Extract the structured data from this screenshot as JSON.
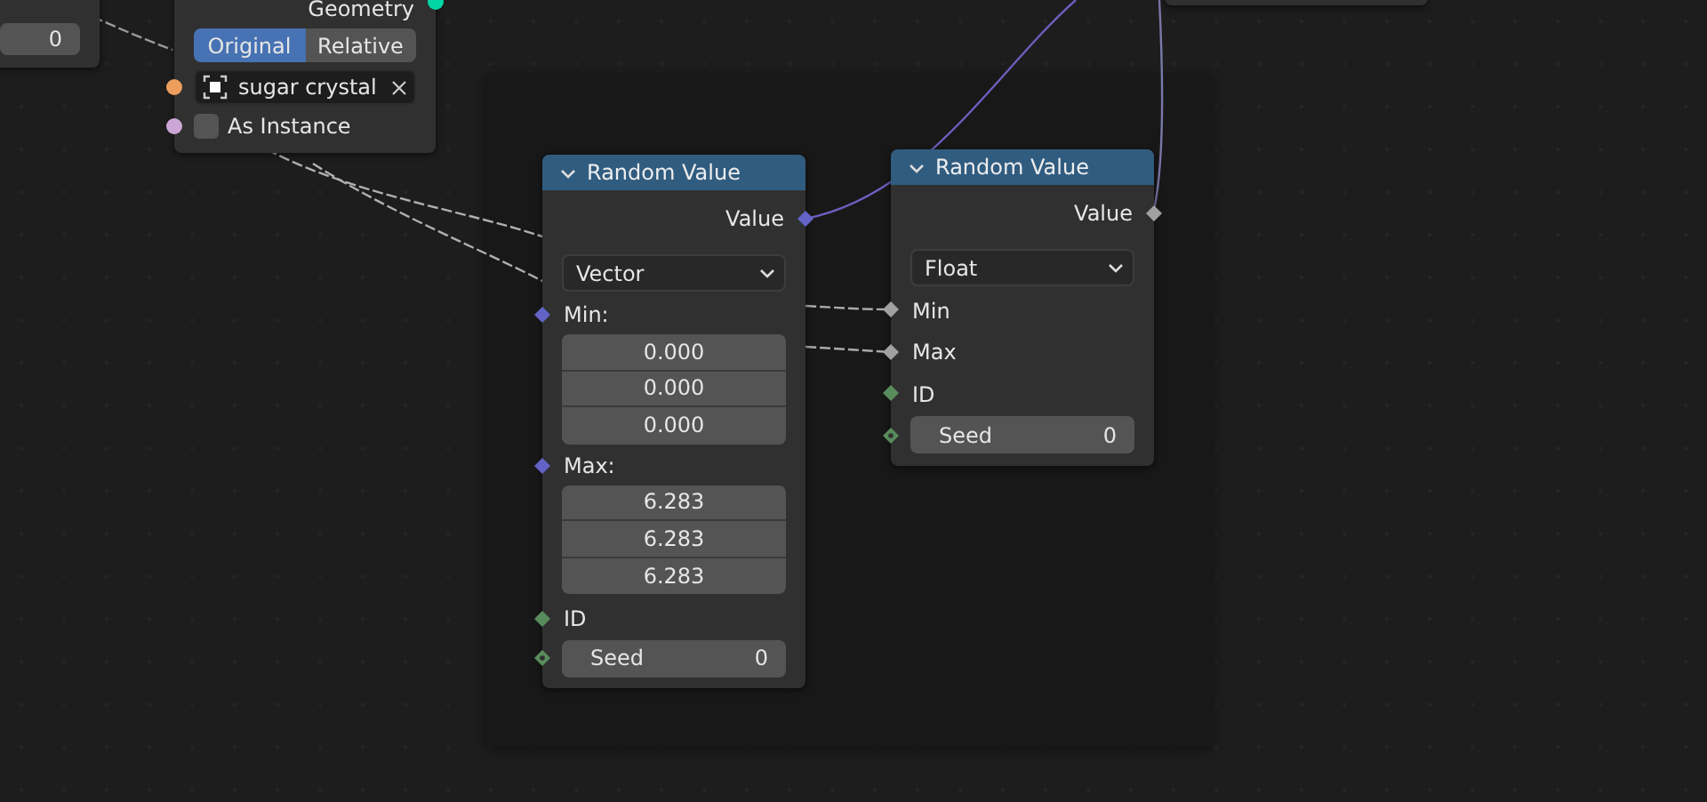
{
  "nodes": [
    {
      "kind": "partial",
      "fields": [
        {
          "value": "0"
        }
      ]
    },
    {
      "kind": "object_info",
      "outputs": [
        {
          "label": "Geometry",
          "socket": {
            "kind": "circle",
            "color": "#00d6a3"
          }
        }
      ],
      "transform": [
        {
          "label": "Original",
          "selected": true
        },
        {
          "label": "Relative",
          "selected": false
        }
      ],
      "object": {
        "name": "sugar crystal",
        "socket": {
          "kind": "circle",
          "color": "#ed9e5c"
        }
      },
      "as_instance": {
        "label": "As Instance",
        "checked": false,
        "socket": {
          "kind": "circle",
          "color": "#cca6d6"
        }
      }
    },
    {
      "kind": "random_value",
      "title": "Random Value",
      "expanded": true,
      "outputs": [
        {
          "label": "Value",
          "socket": {
            "kind": "diamond",
            "color": "#6363c7"
          }
        }
      ],
      "data_type": "Vector",
      "inputs": [
        {
          "kind": "vector",
          "label": "Min:",
          "socket": {
            "kind": "diamond",
            "color": "#6363c7"
          },
          "values": [
            "0.000",
            "0.000",
            "0.000"
          ]
        },
        {
          "kind": "vector",
          "label": "Max:",
          "socket": {
            "kind": "diamond",
            "color": "#6363c7"
          },
          "values": [
            "6.283",
            "6.283",
            "6.283"
          ]
        },
        {
          "kind": "socket",
          "label": "ID",
          "socket": {
            "kind": "diamond",
            "color": "#598c5c"
          }
        },
        {
          "kind": "field",
          "label": "Seed",
          "value": "0",
          "socket": {
            "kind": "diamond_dot",
            "color": "#598c5c"
          }
        }
      ]
    },
    {
      "kind": "random_value",
      "title": "Random Value",
      "expanded": true,
      "outputs": [
        {
          "label": "Value",
          "socket": {
            "kind": "diamond",
            "color": "#a1a1a1"
          }
        }
      ],
      "data_type": "Float",
      "inputs": [
        {
          "kind": "socket",
          "label": "Min",
          "socket": {
            "kind": "diamond",
            "color": "#a1a1a1"
          }
        },
        {
          "kind": "socket",
          "label": "Max",
          "socket": {
            "kind": "diamond",
            "color": "#a1a1a1"
          }
        },
        {
          "kind": "socket",
          "label": "ID",
          "socket": {
            "kind": "diamond",
            "color": "#598c5c"
          }
        },
        {
          "kind": "field",
          "label": "Seed",
          "value": "0",
          "socket": {
            "kind": "diamond_dot",
            "color": "#598c5c"
          }
        }
      ]
    },
    {
      "kind": "partial_bottom"
    }
  ]
}
